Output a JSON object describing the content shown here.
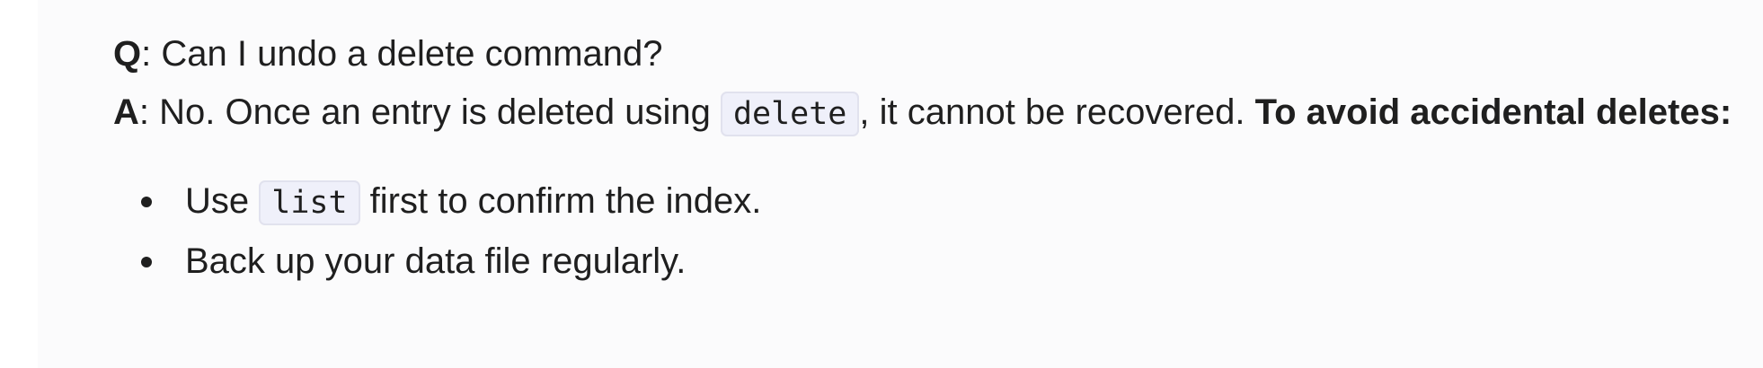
{
  "faq": {
    "question": {
      "label": "Q",
      "separator": ":",
      "text": " Can I undo a delete command?"
    },
    "answer": {
      "label": "A",
      "separator": ":",
      "text_before": " No. Once an entry is deleted using ",
      "code": "delete",
      "text_after": ", it cannot be recovered. ",
      "emphasis": "To avoid accidental deletes:"
    },
    "tips": [
      {
        "before": "Use ",
        "code": "list",
        "after": " first to confirm the index."
      },
      {
        "text": "Back up your data file regularly."
      }
    ]
  }
}
